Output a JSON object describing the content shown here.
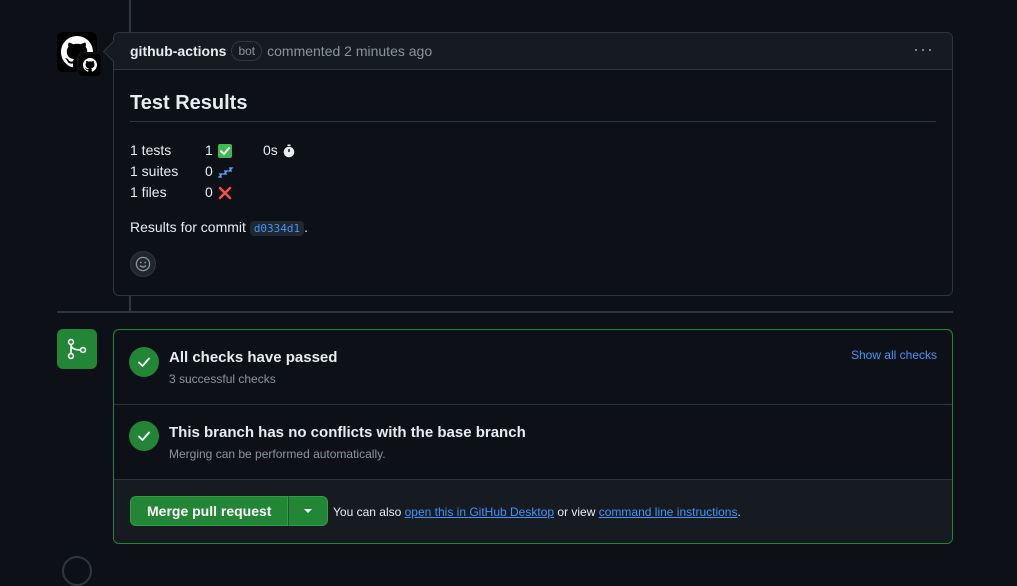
{
  "comment": {
    "author": "github-actions",
    "badge": "bot",
    "meta": "commented 2 minutes ago",
    "more_label": "···",
    "title": "Test Results",
    "stats": [
      {
        "label": "1 tests",
        "count": "1",
        "icon": "white-check-mark-icon",
        "extra": "0s",
        "extra_icon": "stopwatch-icon"
      },
      {
        "label": "1 suites",
        "count": "0",
        "icon": "zzz-icon"
      },
      {
        "label": "1 files",
        "count": "0",
        "icon": "x-icon"
      }
    ],
    "commit_prefix": "Results for commit",
    "commit_sha": "d0334d1",
    "commit_suffix": "."
  },
  "merge": {
    "checks_title": "All checks have passed",
    "checks_subtitle": "3 successful checks",
    "show_all": "Show all checks",
    "conflicts_title": "This branch has no conflicts with the base branch",
    "conflicts_subtitle": "Merging can be performed automatically.",
    "merge_button": "Merge pull request",
    "also_prefix": "You can also",
    "desktop_link": "open this in GitHub Desktop",
    "or_view": "or view",
    "cli_link": "command line instructions",
    "suffix": "."
  },
  "colors": {
    "success": "#238636",
    "link": "#4493f8",
    "danger": "#f85149"
  }
}
